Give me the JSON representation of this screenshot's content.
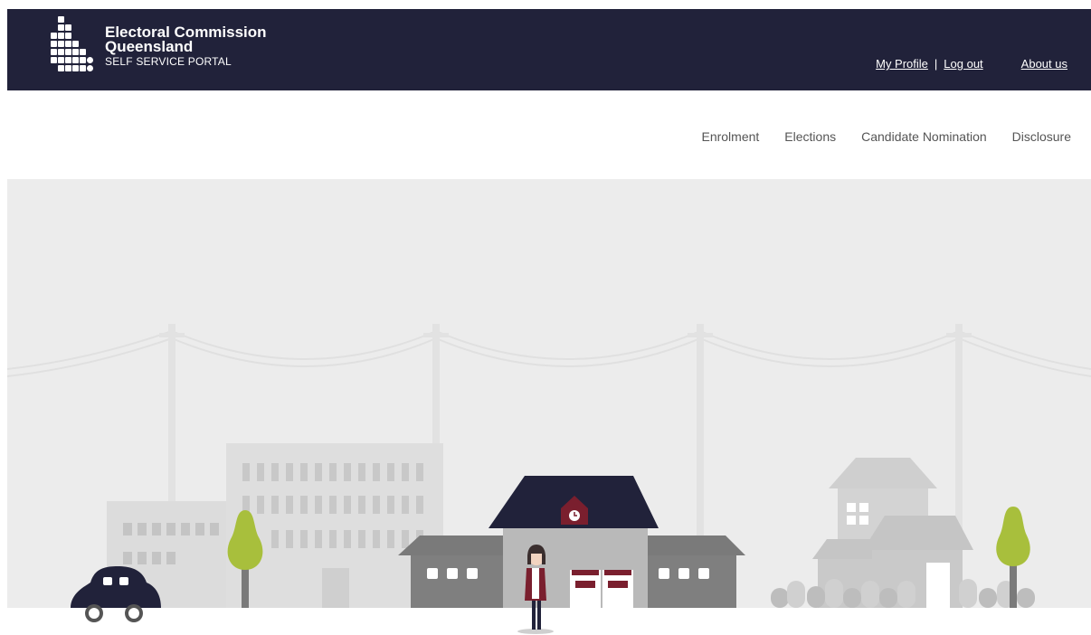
{
  "header": {
    "brand_line1": "Electoral Commission",
    "brand_line2": "Queensland",
    "brand_sub": "SELF SERVICE PORTAL",
    "links": {
      "my_profile": "My Profile",
      "separator": "|",
      "log_out": "Log out",
      "about_us": "About us"
    },
    "colors": {
      "background": "#21223a",
      "text": "#ffffff"
    }
  },
  "nav": {
    "items": [
      {
        "label": "Enrolment"
      },
      {
        "label": "Elections"
      },
      {
        "label": "Candidate Nomination"
      },
      {
        "label": "Disclosure"
      }
    ]
  },
  "hero": {
    "colors": {
      "background": "#ececec",
      "ground": "#ffffff",
      "roof": "#21223a",
      "accent": "#7a1f2e",
      "tree": "#a8bf3c",
      "car": "#21223a"
    }
  }
}
